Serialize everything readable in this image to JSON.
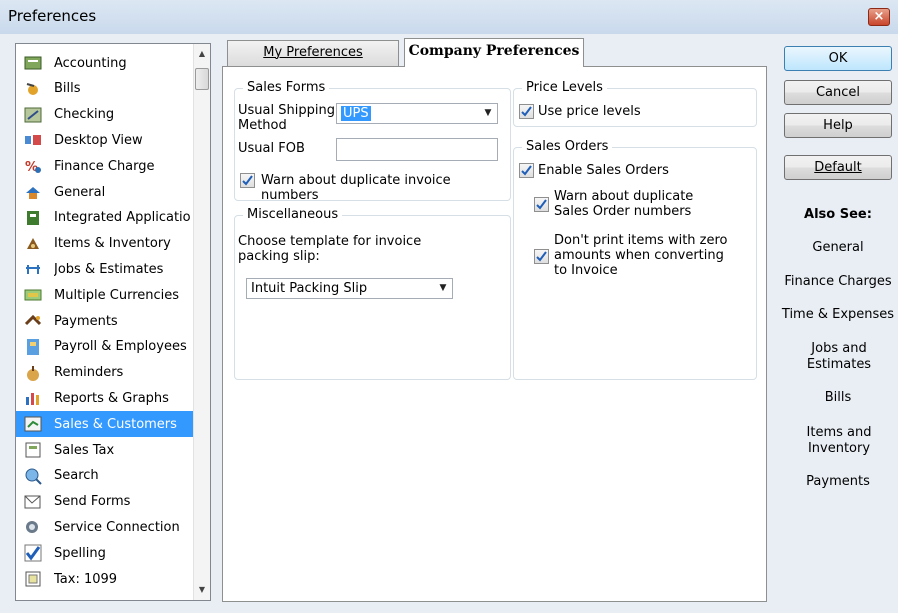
{
  "window": {
    "title": "Preferences",
    "close_glyph": "×"
  },
  "sidebar": {
    "items": [
      {
        "label": "Accounting",
        "icon": "accounting-icon"
      },
      {
        "label": "Bills",
        "icon": "bills-icon"
      },
      {
        "label": "Checking",
        "icon": "checking-icon"
      },
      {
        "label": "Desktop View",
        "icon": "desktop-view-icon"
      },
      {
        "label": "Finance Charge",
        "icon": "finance-charge-icon"
      },
      {
        "label": "General",
        "icon": "general-icon"
      },
      {
        "label": "Integrated Applicatio",
        "icon": "integrated-applications-icon"
      },
      {
        "label": "Items & Inventory",
        "icon": "items-inventory-icon"
      },
      {
        "label": "Jobs & Estimates",
        "icon": "jobs-estimates-icon"
      },
      {
        "label": "Multiple Currencies",
        "icon": "multiple-currencies-icon"
      },
      {
        "label": "Payments",
        "icon": "payments-icon"
      },
      {
        "label": "Payroll & Employees",
        "icon": "payroll-employees-icon"
      },
      {
        "label": "Reminders",
        "icon": "reminders-icon"
      },
      {
        "label": "Reports & Graphs",
        "icon": "reports-graphs-icon"
      },
      {
        "label": "Sales & Customers",
        "icon": "sales-customers-icon",
        "selected": true
      },
      {
        "label": "Sales Tax",
        "icon": "sales-tax-icon"
      },
      {
        "label": "Search",
        "icon": "search-icon"
      },
      {
        "label": "Send Forms",
        "icon": "send-forms-icon"
      },
      {
        "label": "Service Connection",
        "icon": "service-connection-icon"
      },
      {
        "label": "Spelling",
        "icon": "spelling-icon"
      },
      {
        "label": "Tax: 1099",
        "icon": "tax-1099-icon"
      }
    ]
  },
  "tabs": {
    "my_preferences": "My Preferences",
    "company_preferences": "Company Preferences",
    "active": "Company Preferences"
  },
  "sales_forms": {
    "title": "Sales Forms",
    "shipping_label_1": "Usual Shipping",
    "shipping_label_2": "Method",
    "shipping_value": "UPS",
    "fob_label": "Usual FOB",
    "fob_value": "",
    "warn_duplicate_label": "Warn about duplicate invoice numbers",
    "warn_duplicate_checked": true
  },
  "miscellaneous": {
    "title": "Miscellaneous",
    "template_label_1": "Choose template for invoice",
    "template_label_2": "packing slip:",
    "template_value": "Intuit Packing Slip"
  },
  "price_levels": {
    "title": "Price Levels",
    "use_label": "Use price levels",
    "use_checked": true
  },
  "sales_orders": {
    "title": "Sales Orders",
    "enable_label": "Enable Sales Orders",
    "enable_checked": true,
    "warn_label_1": "Warn about duplicate",
    "warn_label_2": "Sales Order numbers",
    "warn_checked": true,
    "zero_label_1": "Don't print items with zero",
    "zero_label_2": "amounts when converting",
    "zero_label_3": "to Invoice",
    "zero_checked": true
  },
  "buttons": {
    "ok": "OK",
    "cancel": "Cancel",
    "help": "Help",
    "default": "Default"
  },
  "also_see": {
    "title": "Also See:",
    "links": [
      "General",
      "Finance Charges",
      "Time & Expenses",
      "Jobs and Estimates",
      "Bills",
      "Items and Inventory",
      "Payments"
    ]
  },
  "colors": {
    "selection": "#3399ff",
    "window_bg": "#e9eef5",
    "check": "#1f5fb8"
  }
}
